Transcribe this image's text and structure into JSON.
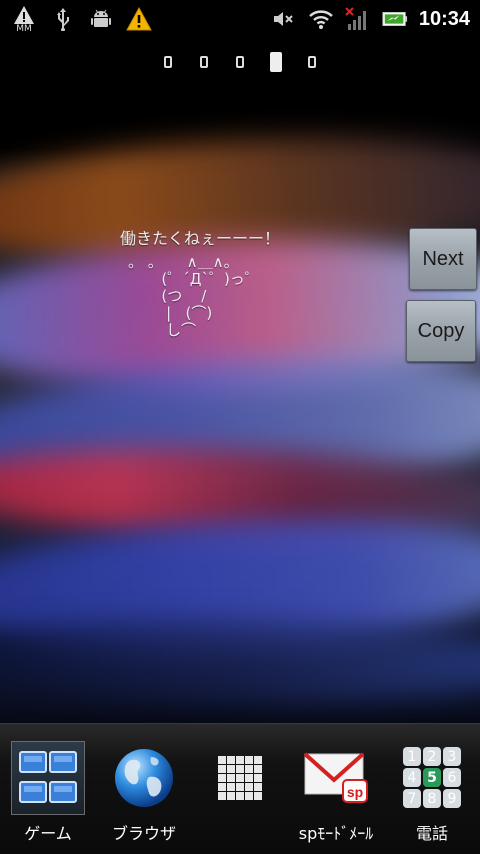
{
  "status_bar": {
    "carrier_label": "MM",
    "time": "10:34",
    "icons": [
      "alert-mm-icon",
      "usb-icon",
      "android-debug-icon",
      "warning-icon",
      "mute-icon",
      "wifi-icon",
      "signal-none-icon",
      "battery-charging-icon"
    ]
  },
  "home_pager": {
    "page_count": 5,
    "active_page": 4
  },
  "widget": {
    "message": "働きたくねぇーーー！",
    "ascii_art": "。 。     ∧＿∧。\n       (゜´Д`゜)っ゜\n       (つ    /\n        |   (⌒)\n        し⌒",
    "next_label": "Next",
    "copy_label": "Copy"
  },
  "dock": {
    "items": [
      {
        "label": "ゲーム",
        "icon": "game-folder-icon"
      },
      {
        "label": "ブラウザ",
        "icon": "browser-globe-icon"
      },
      {
        "label": "",
        "icon": "app-drawer-icon"
      },
      {
        "label": "spﾓｰﾄﾞﾒｰﾙ",
        "icon": "sp-mode-mail-icon"
      },
      {
        "label": "電話",
        "icon": "phone-dialpad-icon"
      }
    ]
  },
  "colors": {
    "status_bar_bg": "#000000",
    "button_face": "#9aa2aa",
    "dock_bg": "#121212"
  }
}
